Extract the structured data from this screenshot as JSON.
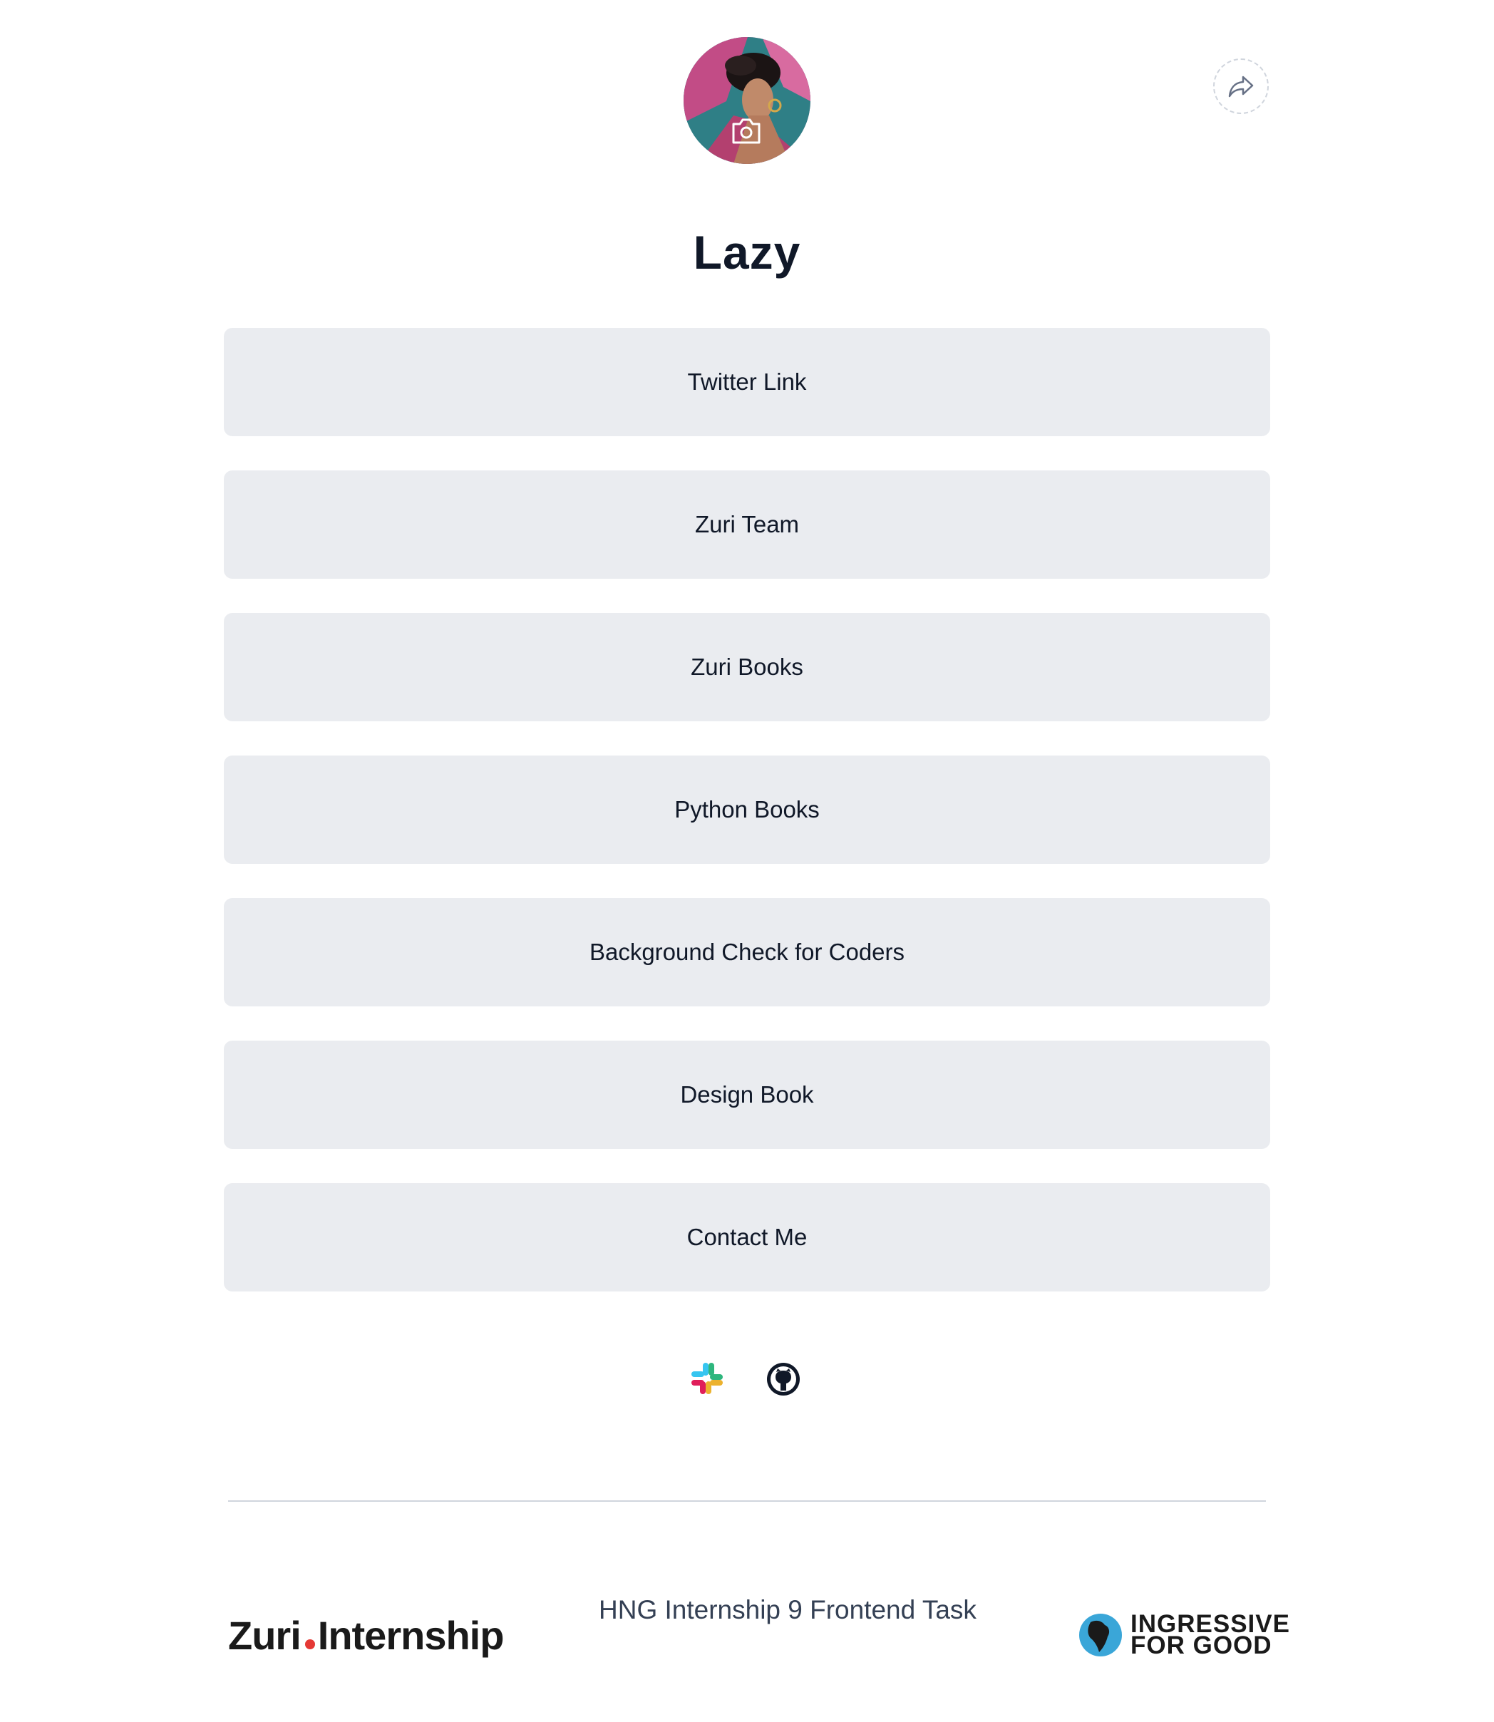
{
  "profile": {
    "name": "Lazy"
  },
  "links": [
    {
      "label": "Twitter Link"
    },
    {
      "label": "Zuri Team"
    },
    {
      "label": "Zuri Books"
    },
    {
      "label": "Python Books"
    },
    {
      "label": "Background Check for Coders"
    },
    {
      "label": "Design Book"
    },
    {
      "label": "Contact Me"
    }
  ],
  "socials": [
    {
      "icon": "slack-icon"
    },
    {
      "icon": "github-icon"
    }
  ],
  "footer": {
    "zuri_logo_part1": "Zuri",
    "zuri_logo_part2": "Internship",
    "task_text": "HNG Internship 9 Frontend Task",
    "i4g_line1": "INGRESSIVE",
    "i4g_line2": "FOR GOOD"
  },
  "colors": {
    "button_bg": "#eaecf0",
    "text": "#101828",
    "divider": "#d0d5dd",
    "zuri_dot": "#e53935"
  }
}
